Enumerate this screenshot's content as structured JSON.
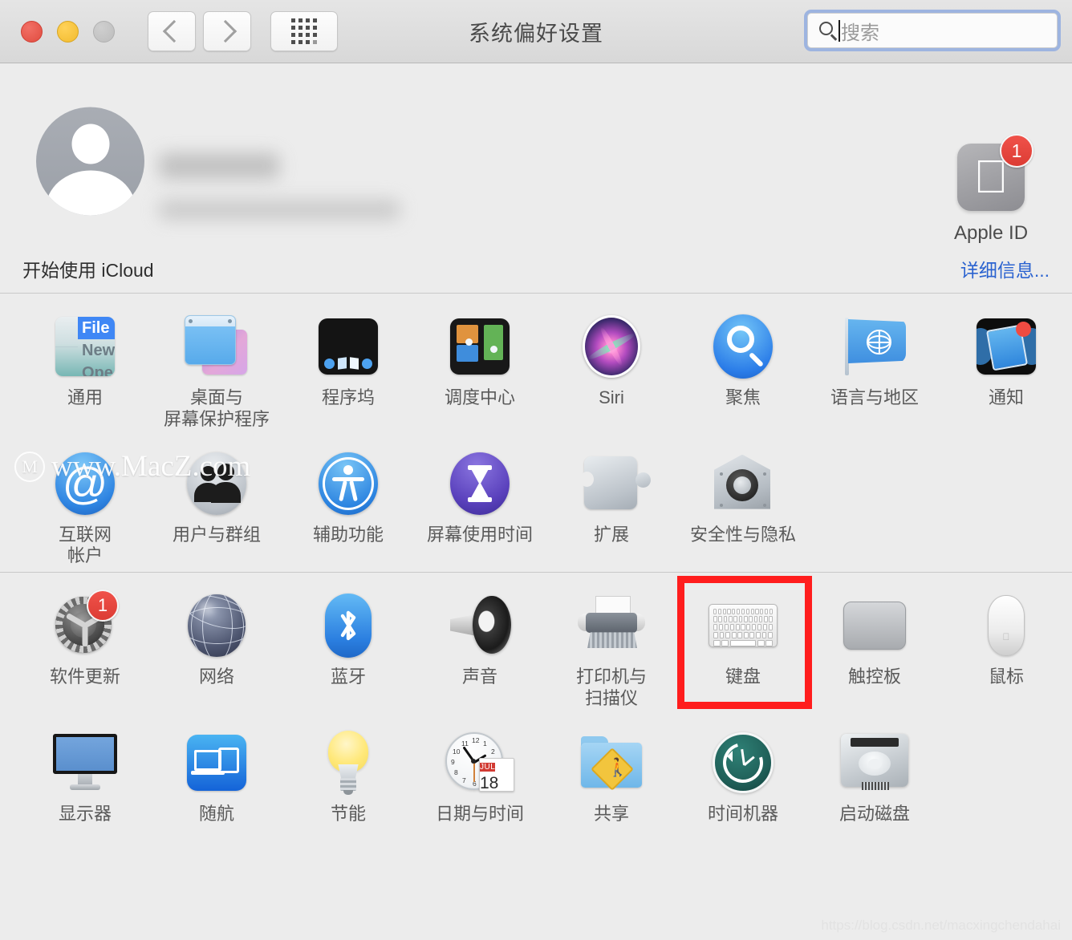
{
  "window": {
    "title": "系统偏好设置",
    "traffic_lights": [
      "close",
      "minimize",
      "zoom"
    ],
    "nav": {
      "back": "‹",
      "forward": "›",
      "grid": "show-all"
    }
  },
  "search": {
    "placeholder": "搜索",
    "value": "",
    "icon": "search-icon"
  },
  "account": {
    "avatar": "user-avatar-placeholder",
    "name_blurred": "",
    "email_blurred": "",
    "apple_id": {
      "label": "Apple ID",
      "badge": "1",
      "icon": "apple-logo"
    }
  },
  "icloud_banner": {
    "text": "开始使用 iCloud",
    "link": "详细信息..."
  },
  "sections": [
    {
      "name": "personal",
      "rows": [
        [
          {
            "label": "通用",
            "icon": "general-icon"
          },
          {
            "label": "桌面与\n屏幕保护程序",
            "icon": "desktop-screensaver-icon"
          },
          {
            "label": "程序坞",
            "icon": "dock-icon"
          },
          {
            "label": "调度中心",
            "icon": "mission-control-icon"
          },
          {
            "label": "Siri",
            "icon": "siri-icon"
          },
          {
            "label": "聚焦",
            "icon": "spotlight-icon"
          },
          {
            "label": "语言与地区",
            "icon": "language-region-icon"
          },
          {
            "label": "通知",
            "icon": "notifications-icon"
          }
        ],
        [
          {
            "label": "互联网\n帐户",
            "icon": "internet-accounts-icon"
          },
          {
            "label": "用户与群组",
            "icon": "users-groups-icon"
          },
          {
            "label": "辅助功能",
            "icon": "accessibility-icon"
          },
          {
            "label": "屏幕使用时间",
            "icon": "screen-time-icon"
          },
          {
            "label": "扩展",
            "icon": "extensions-icon"
          },
          {
            "label": "安全性与隐私",
            "icon": "security-privacy-icon"
          }
        ]
      ]
    },
    {
      "name": "hardware",
      "rows": [
        [
          {
            "label": "软件更新",
            "icon": "software-update-icon",
            "badge": "1"
          },
          {
            "label": "网络",
            "icon": "network-icon"
          },
          {
            "label": "蓝牙",
            "icon": "bluetooth-icon"
          },
          {
            "label": "声音",
            "icon": "sound-icon"
          },
          {
            "label": "打印机与\n扫描仪",
            "icon": "printers-scanners-icon"
          },
          {
            "label": "键盘",
            "icon": "keyboard-icon",
            "highlighted": true
          },
          {
            "label": "触控板",
            "icon": "trackpad-icon"
          },
          {
            "label": "鼠标",
            "icon": "mouse-icon"
          }
        ],
        [
          {
            "label": "显示器",
            "icon": "displays-icon"
          },
          {
            "label": "随航",
            "icon": "sidecar-icon"
          },
          {
            "label": "节能",
            "icon": "energy-saver-icon"
          },
          {
            "label": "日期与时间",
            "icon": "date-time-icon",
            "month": "JUL",
            "day": "18"
          },
          {
            "label": "共享",
            "icon": "sharing-icon"
          },
          {
            "label": "时间机器",
            "icon": "time-machine-icon"
          },
          {
            "label": "启动磁盘",
            "icon": "startup-disk-icon"
          }
        ]
      ]
    }
  ],
  "watermarks": {
    "macz": "www.MacZ.com",
    "macz_logo": "M",
    "csdn": "https://blog.csdn.net/macxingchendahai"
  },
  "colors": {
    "highlight": "#ff1d1d",
    "link": "#2b63d0",
    "badge": "#dc3c34",
    "window_bg": "#ececec"
  }
}
